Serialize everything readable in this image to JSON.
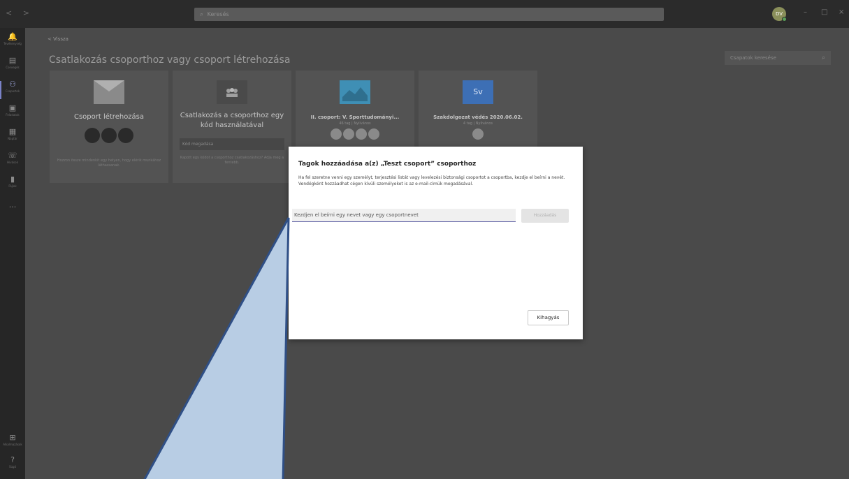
{
  "titlebar": {
    "nav": "< >",
    "search_placeholder": "Keresés",
    "avatar": "DV",
    "minimize": "–",
    "maximize": "□",
    "close": "×"
  },
  "rail": [
    {
      "icon": "bell-icon",
      "glyph": "🔔",
      "label": "Tevékenység"
    },
    {
      "icon": "chat-icon",
      "glyph": "▤",
      "label": "Csevegés"
    },
    {
      "icon": "teams-icon",
      "glyph": "⚇",
      "label": "Csoportok"
    },
    {
      "icon": "assignments-icon",
      "glyph": "▣",
      "label": "Feladatok"
    },
    {
      "icon": "calendar-icon",
      "glyph": "▦",
      "label": "Naptár"
    },
    {
      "icon": "calls-icon",
      "glyph": "☏",
      "label": "Hívások"
    },
    {
      "icon": "files-icon",
      "glyph": "▮",
      "label": "Fájlok"
    },
    {
      "icon": "more-icon",
      "glyph": "···",
      "label": ""
    }
  ],
  "rail_bottom": [
    {
      "icon": "apps-icon",
      "glyph": "⊞",
      "label": "Alkalmazások"
    },
    {
      "icon": "help-icon",
      "glyph": "?",
      "label": "Súgó"
    }
  ],
  "main": {
    "back": "< Vissza",
    "title": "Csatlakozás csoporthoz vagy csoport létrehozása",
    "team_search_placeholder": "Csapatok keresése"
  },
  "cards": [
    {
      "title": "Csoport létrehozása",
      "desc": "Hozzon össze mindenkit egy helyen, hogy elérik munkához láthassanak."
    },
    {
      "title": "Csatlakozás a csoporthoz egy kód használatával",
      "code_placeholder": "Kód megadása",
      "desc": "Kapott egy kódot a csoporthoz csatlakozáshoz? Adja meg a fentebb."
    },
    {
      "title": "II. csoport: V. Sporttudományi...",
      "sub": "46 tag | Nyilvános"
    },
    {
      "title": "Szakdolgozat védés 2020.06.02.",
      "sub": "4 tag | Nyilvános",
      "badge": "Sv"
    }
  ],
  "dialog": {
    "title": "Tagok hozzáadása a(z) „Teszt csoport” csoporthoz",
    "body": "Ha fel szeretne venni egy személyt, terjesztési listát vagy levelezési biztonsági csoportot a csoportba, kezdje el beírni a nevét. Vendégként hozzáadhat cégen kívüli személyeket is az e-mail-címük megadásával.",
    "input_placeholder": "Kezdjen el beírni egy nevet vagy egy csoportnevet",
    "add_label": "Hozzáadás",
    "skip_label": "Kihagyás"
  },
  "colors": {
    "accent": "#6264a7",
    "callout_fill": "#b8cde4",
    "callout_stroke": "#2f4f86"
  }
}
